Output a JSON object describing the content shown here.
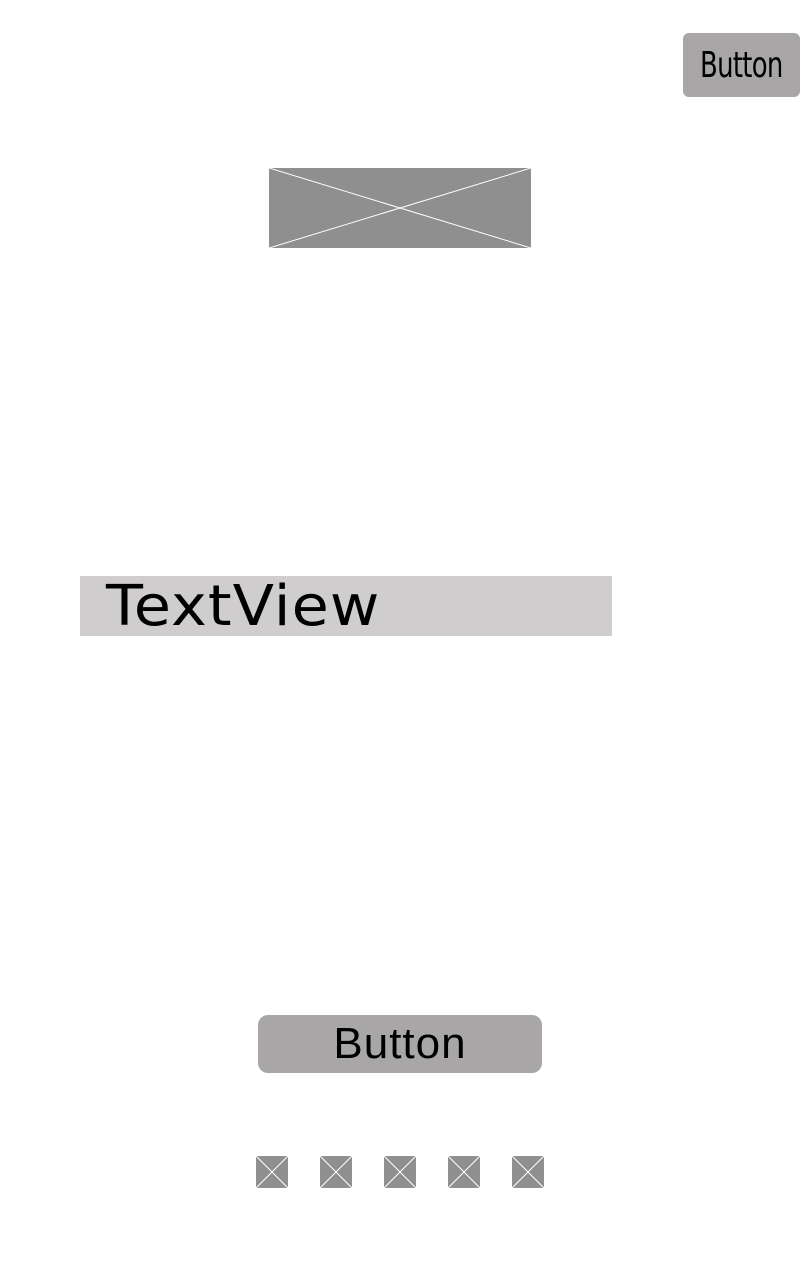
{
  "top_button": {
    "label": "Button"
  },
  "banner_image": {
    "icon": "image-placeholder-icon"
  },
  "text_view": {
    "text": "TextView"
  },
  "bottom_button": {
    "label": "Button"
  },
  "page_indicators": {
    "count": 5,
    "icon": "image-placeholder-icon"
  },
  "colors": {
    "button_bg": "#a8a6a6",
    "placeholder_bg": "#8f8f8f",
    "textview_bg": "#cfcdcd",
    "background": "#ffffff"
  }
}
